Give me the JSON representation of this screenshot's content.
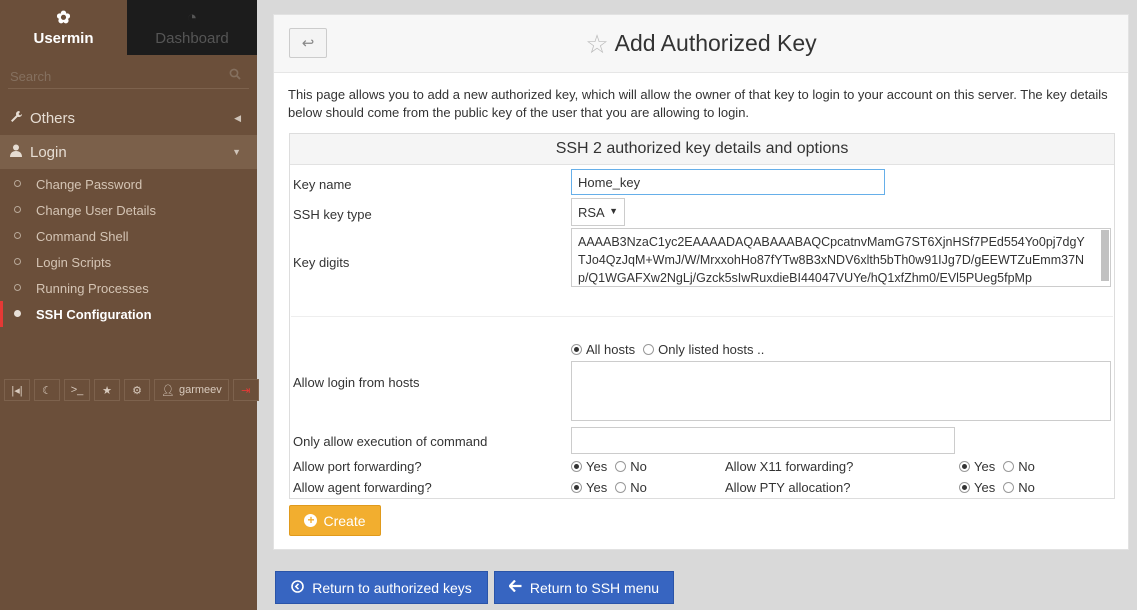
{
  "sidebar": {
    "tabs": [
      {
        "label": "Usermin",
        "icon": "usermin-logo-icon"
      },
      {
        "label": "Dashboard",
        "icon": "dashboard-icon"
      }
    ],
    "search_placeholder": "Search",
    "sections": [
      {
        "label": "Others",
        "icon": "wrench-icon"
      },
      {
        "label": "Login",
        "icon": "user-icon"
      }
    ],
    "items": [
      {
        "label": "Change Password"
      },
      {
        "label": "Change User Details"
      },
      {
        "label": "Command Shell"
      },
      {
        "label": "Login Scripts"
      },
      {
        "label": "Running Processes"
      },
      {
        "label": "SSH Configuration"
      }
    ],
    "active_item": "SSH Configuration",
    "toolbar": {
      "username": "garmeev"
    }
  },
  "header": {
    "title": "Add Authorized Key",
    "back_icon": "return-arrow-icon",
    "star_icon": "star-icon"
  },
  "intro": "This page allows you to add a new authorized key, which will allow the owner of that key to login to your account on this server. The key details below should come from the public key of the user that you are allowing to login.",
  "form": {
    "heading": "SSH 2 authorized key details and options",
    "key_name_label": "Key name",
    "key_name_value": "Home_key",
    "key_type_label": "SSH key type",
    "key_type_value": "RSA",
    "key_digits_label": "Key digits",
    "key_digits_value": "AAAAB3NzaC1yc2EAAAADAQABAAABAQCpcatnvMamG7ST6XjnHSf7PEd554Yo0pj7dgYTJo4QzJqM+WmJ/W/MrxxohHo87fYTw8B3xNDV6xlth5bTh0w91IJg7D/gEEWTZuEmm37Np/Q1WGAFXw2NgLj/Gzck5sIwRuxdieBI44047VUYe/hQ1xfZhm0/EVl5PUeg5fpMp",
    "hosts_label": "Allow login from hosts",
    "hosts_options": [
      "All hosts",
      "Only listed hosts .."
    ],
    "hosts_selected": "All hosts",
    "command_label": "Only allow execution of command",
    "port_fwd_label": "Allow port forwarding?",
    "x11_fwd_label": "Allow X11 forwarding?",
    "agent_fwd_label": "Allow agent forwarding?",
    "pty_label": "Allow PTY allocation?",
    "yes": "Yes",
    "no": "No"
  },
  "buttons": {
    "create": "Create",
    "return_keys": "Return to authorized keys",
    "return_ssh": "Return to SSH menu"
  },
  "colors": {
    "sidebar_bg": "#6b4f3a",
    "create_btn": "#f2ae2f",
    "primary_btn": "#3765c1",
    "active_marker": "#e53935"
  }
}
